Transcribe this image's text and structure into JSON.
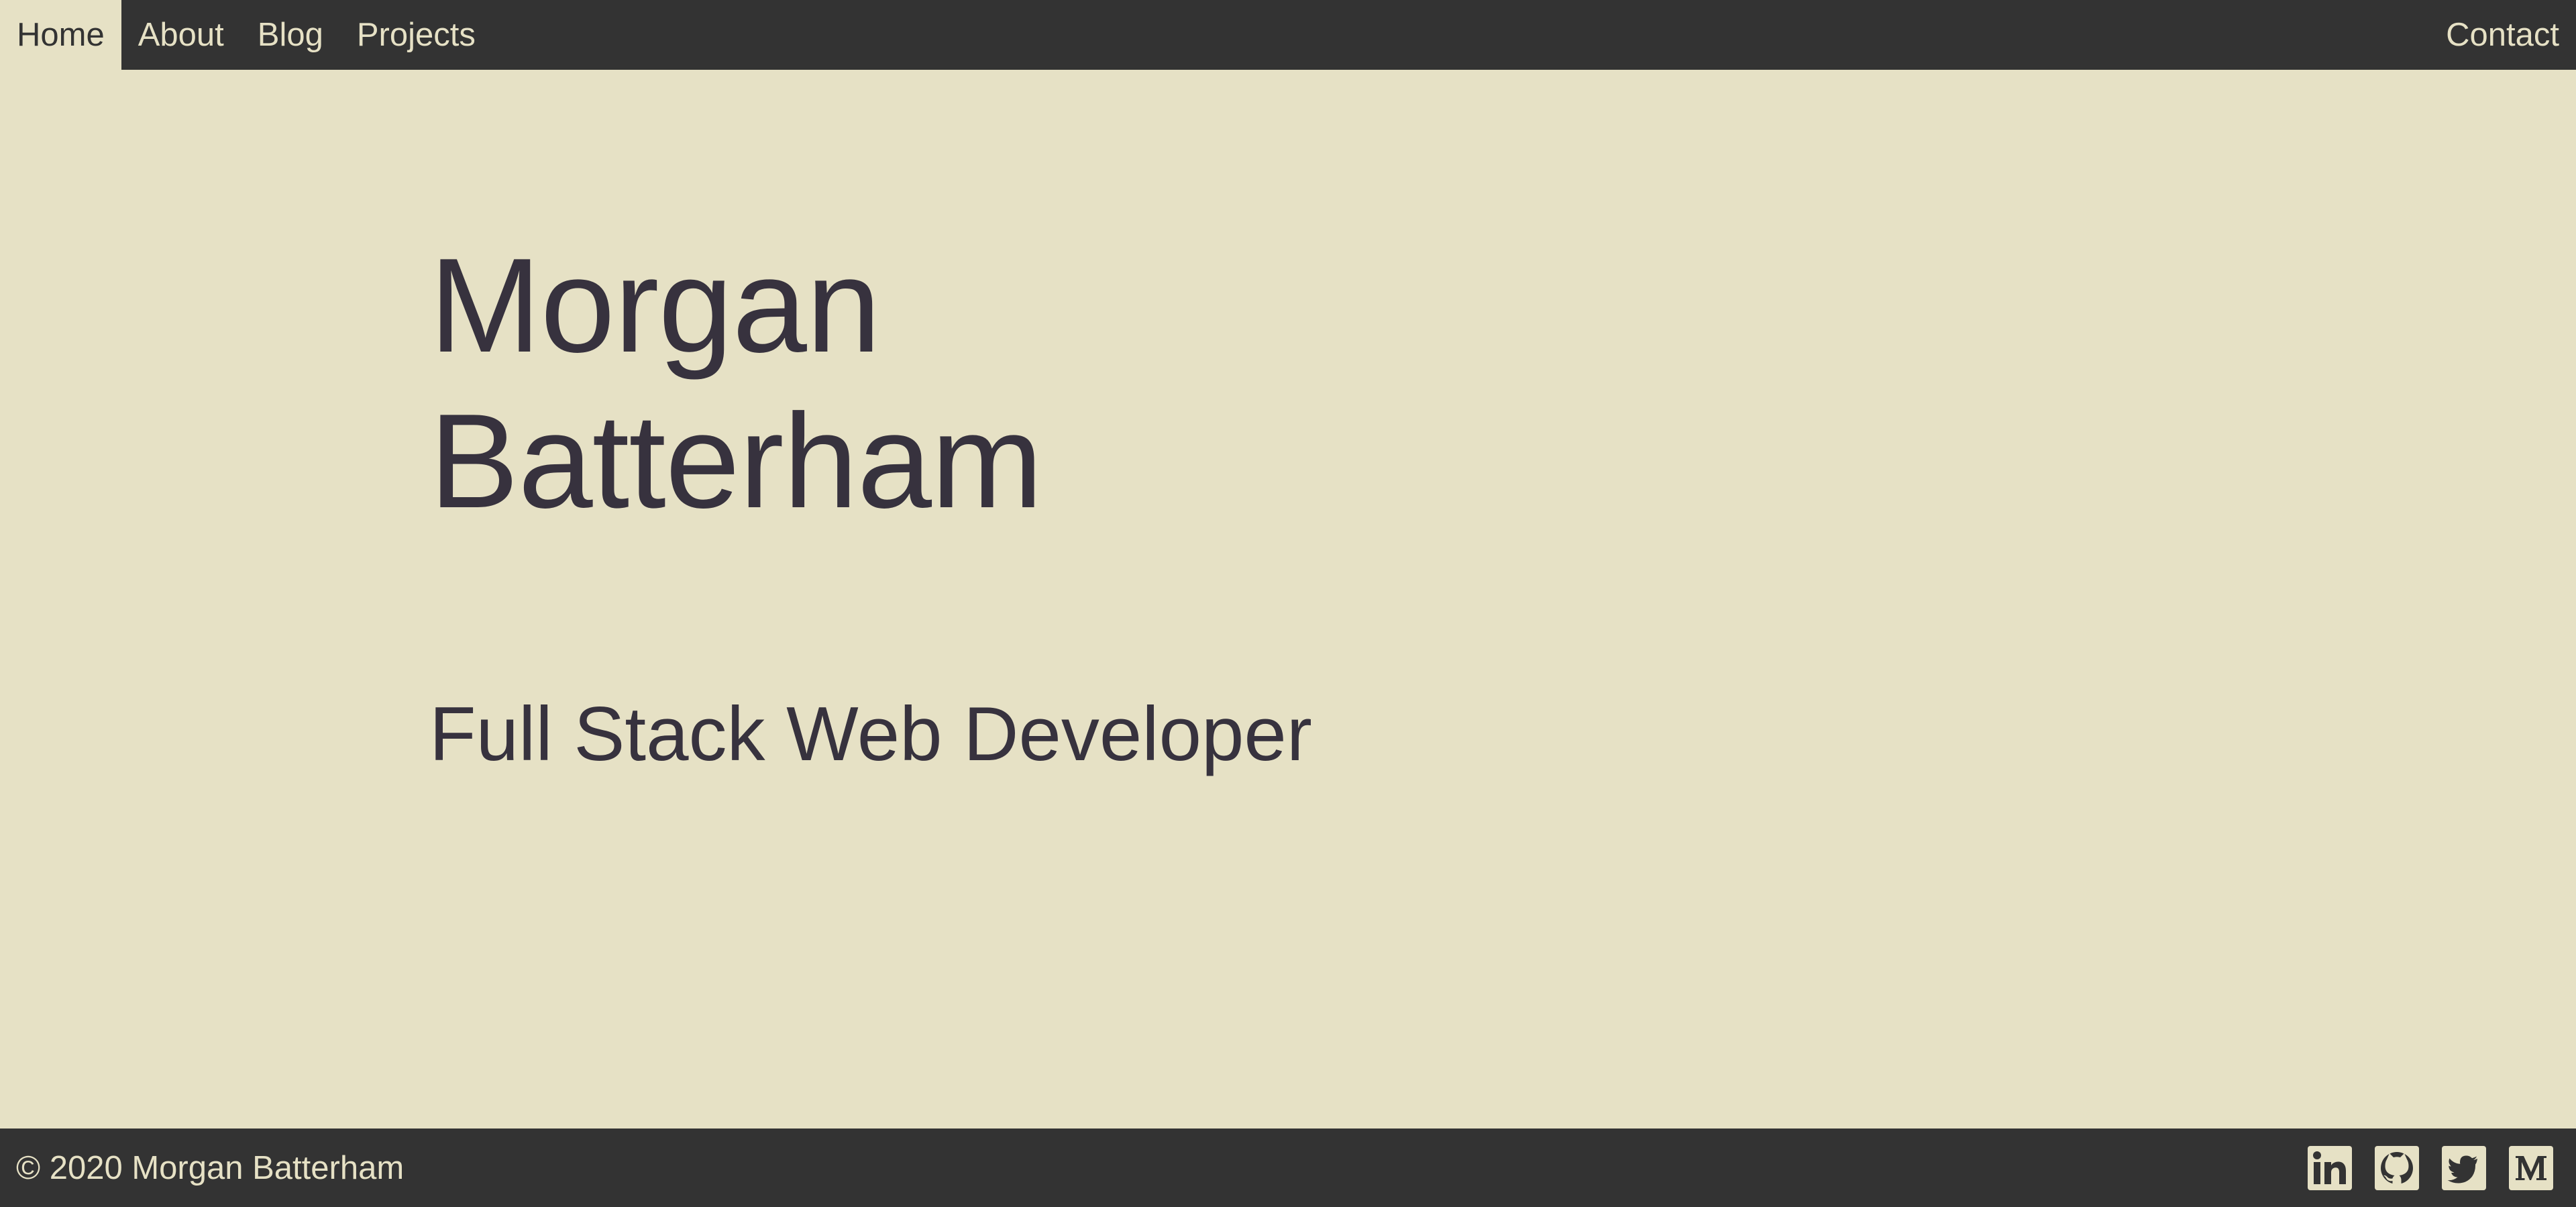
{
  "colors": {
    "background": "#e6e1c5",
    "bar": "#333333",
    "text": "#37323e",
    "bar_text": "#e6e1c5"
  },
  "nav": {
    "items": [
      {
        "label": "Home",
        "active": true
      },
      {
        "label": "About",
        "active": false
      },
      {
        "label": "Blog",
        "active": false
      },
      {
        "label": "Projects",
        "active": false
      }
    ],
    "contact_label": "Contact"
  },
  "hero": {
    "name_first": "Morgan",
    "name_last": "Batterham",
    "role": "Full Stack Web Developer"
  },
  "footer": {
    "copyright": "© 2020 Morgan Batterham",
    "social": [
      {
        "icon": "linkedin-icon"
      },
      {
        "icon": "github-icon"
      },
      {
        "icon": "twitter-icon"
      },
      {
        "icon": "medium-icon"
      }
    ]
  }
}
